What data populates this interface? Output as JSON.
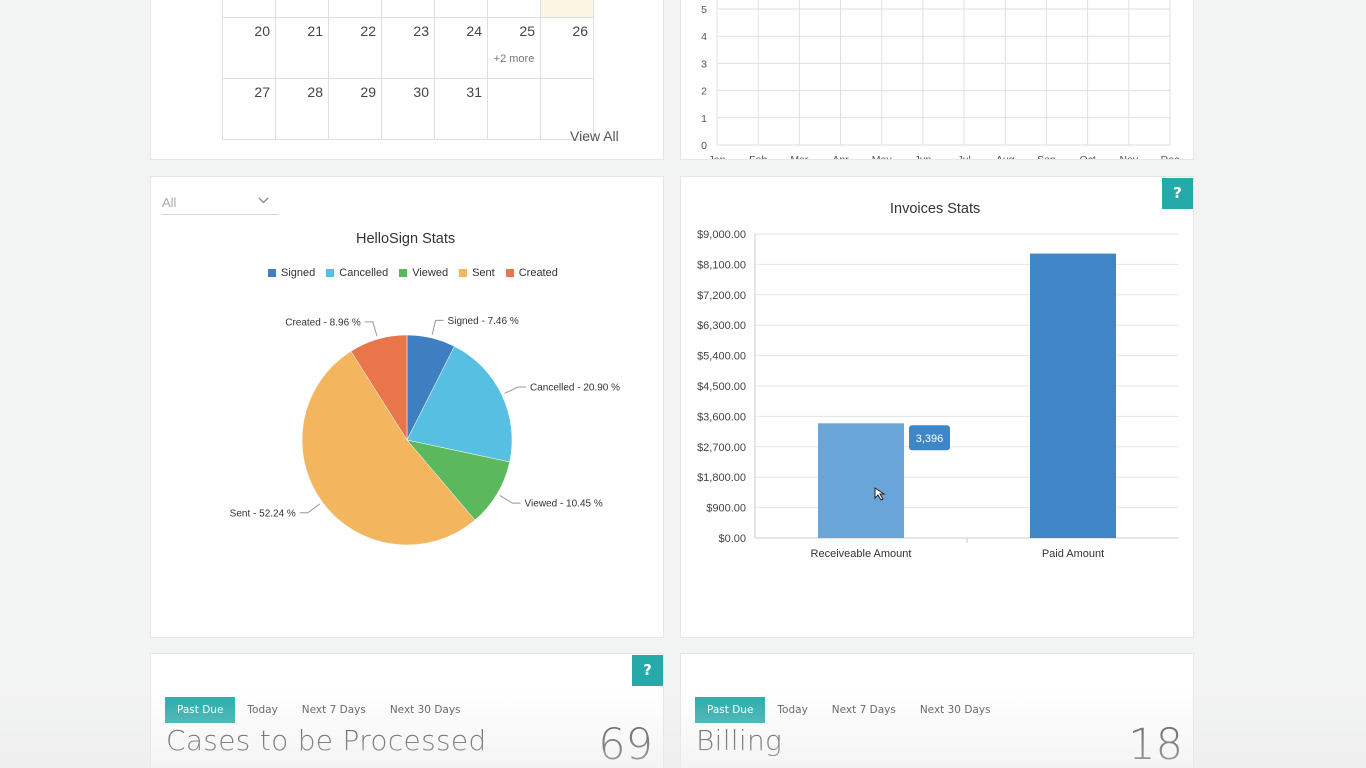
{
  "calendar": {
    "rows": [
      [
        "",
        "",
        "",
        "",
        "",
        "",
        ""
      ],
      [
        "20",
        "21",
        "22",
        "23",
        "24",
        "25",
        "26"
      ],
      [
        "27",
        "28",
        "29",
        "30",
        "31",
        "",
        ""
      ]
    ],
    "more_label": "+2 more",
    "view_all": "View All"
  },
  "line_chart": {
    "y_ticks": [
      "5",
      "4",
      "3",
      "2",
      "1",
      "0"
    ],
    "months": [
      "Jan",
      "Feb",
      "Mar",
      "Apr",
      "May",
      "Jun",
      "Jul",
      "Aug",
      "Sep",
      "Oct",
      "Nov",
      "Dec"
    ]
  },
  "hellosign": {
    "filter_value": "All",
    "title": "HelloSign Stats",
    "legend": [
      {
        "label": "Signed",
        "color": "#3f7fc1"
      },
      {
        "label": "Cancelled",
        "color": "#57bfe1"
      },
      {
        "label": "Viewed",
        "color": "#5cb85c"
      },
      {
        "label": "Sent",
        "color": "#f4b55f"
      },
      {
        "label": "Created",
        "color": "#e8764a"
      }
    ]
  },
  "invoices": {
    "title": "Invoices Stats",
    "tooltip": "3,396",
    "help_label": "?"
  },
  "cases": {
    "help_label": "?",
    "tabs": [
      "Past Due",
      "Today",
      "Next 7 Days",
      "Next 30 Days"
    ],
    "title": "Cases to be Processed",
    "count": "69"
  },
  "billing": {
    "tabs": [
      "Past Due",
      "Today",
      "Next 7 Days",
      "Next 30 Days"
    ],
    "title": "Billing",
    "count": "18"
  },
  "chart_data": [
    {
      "type": "pie",
      "title": "HelloSign Stats",
      "categories": [
        "Signed",
        "Cancelled",
        "Viewed",
        "Sent",
        "Created"
      ],
      "values": [
        7.46,
        20.9,
        10.45,
        52.24,
        8.96
      ],
      "labels": [
        "Signed - 7.46 %",
        "Cancelled - 20.90 %",
        "Viewed - 10.45 %",
        "Sent - 52.24 %",
        "Created - 8.96 %"
      ],
      "colors": [
        "#3f7fc1",
        "#57bfe1",
        "#5cb85c",
        "#f4b55f",
        "#e8764a"
      ],
      "legend": "top"
    },
    {
      "type": "bar",
      "title": "Invoices Stats",
      "categories": [
        "Receiveable Amount",
        "Paid Amount"
      ],
      "values": [
        3396,
        8420
      ],
      "ylim": [
        0,
        9000
      ],
      "y_ticks": [
        "$0.00",
        "$900.00",
        "$1,800.00",
        "$2,700.00",
        "$3,600.00",
        "$4,500.00",
        "$5,400.00",
        "$6,300.00",
        "$7,200.00",
        "$8,100.00",
        "$9,000.00"
      ],
      "colors": [
        "#6aa5da",
        "#3f86c8"
      ],
      "grid": true
    }
  ]
}
